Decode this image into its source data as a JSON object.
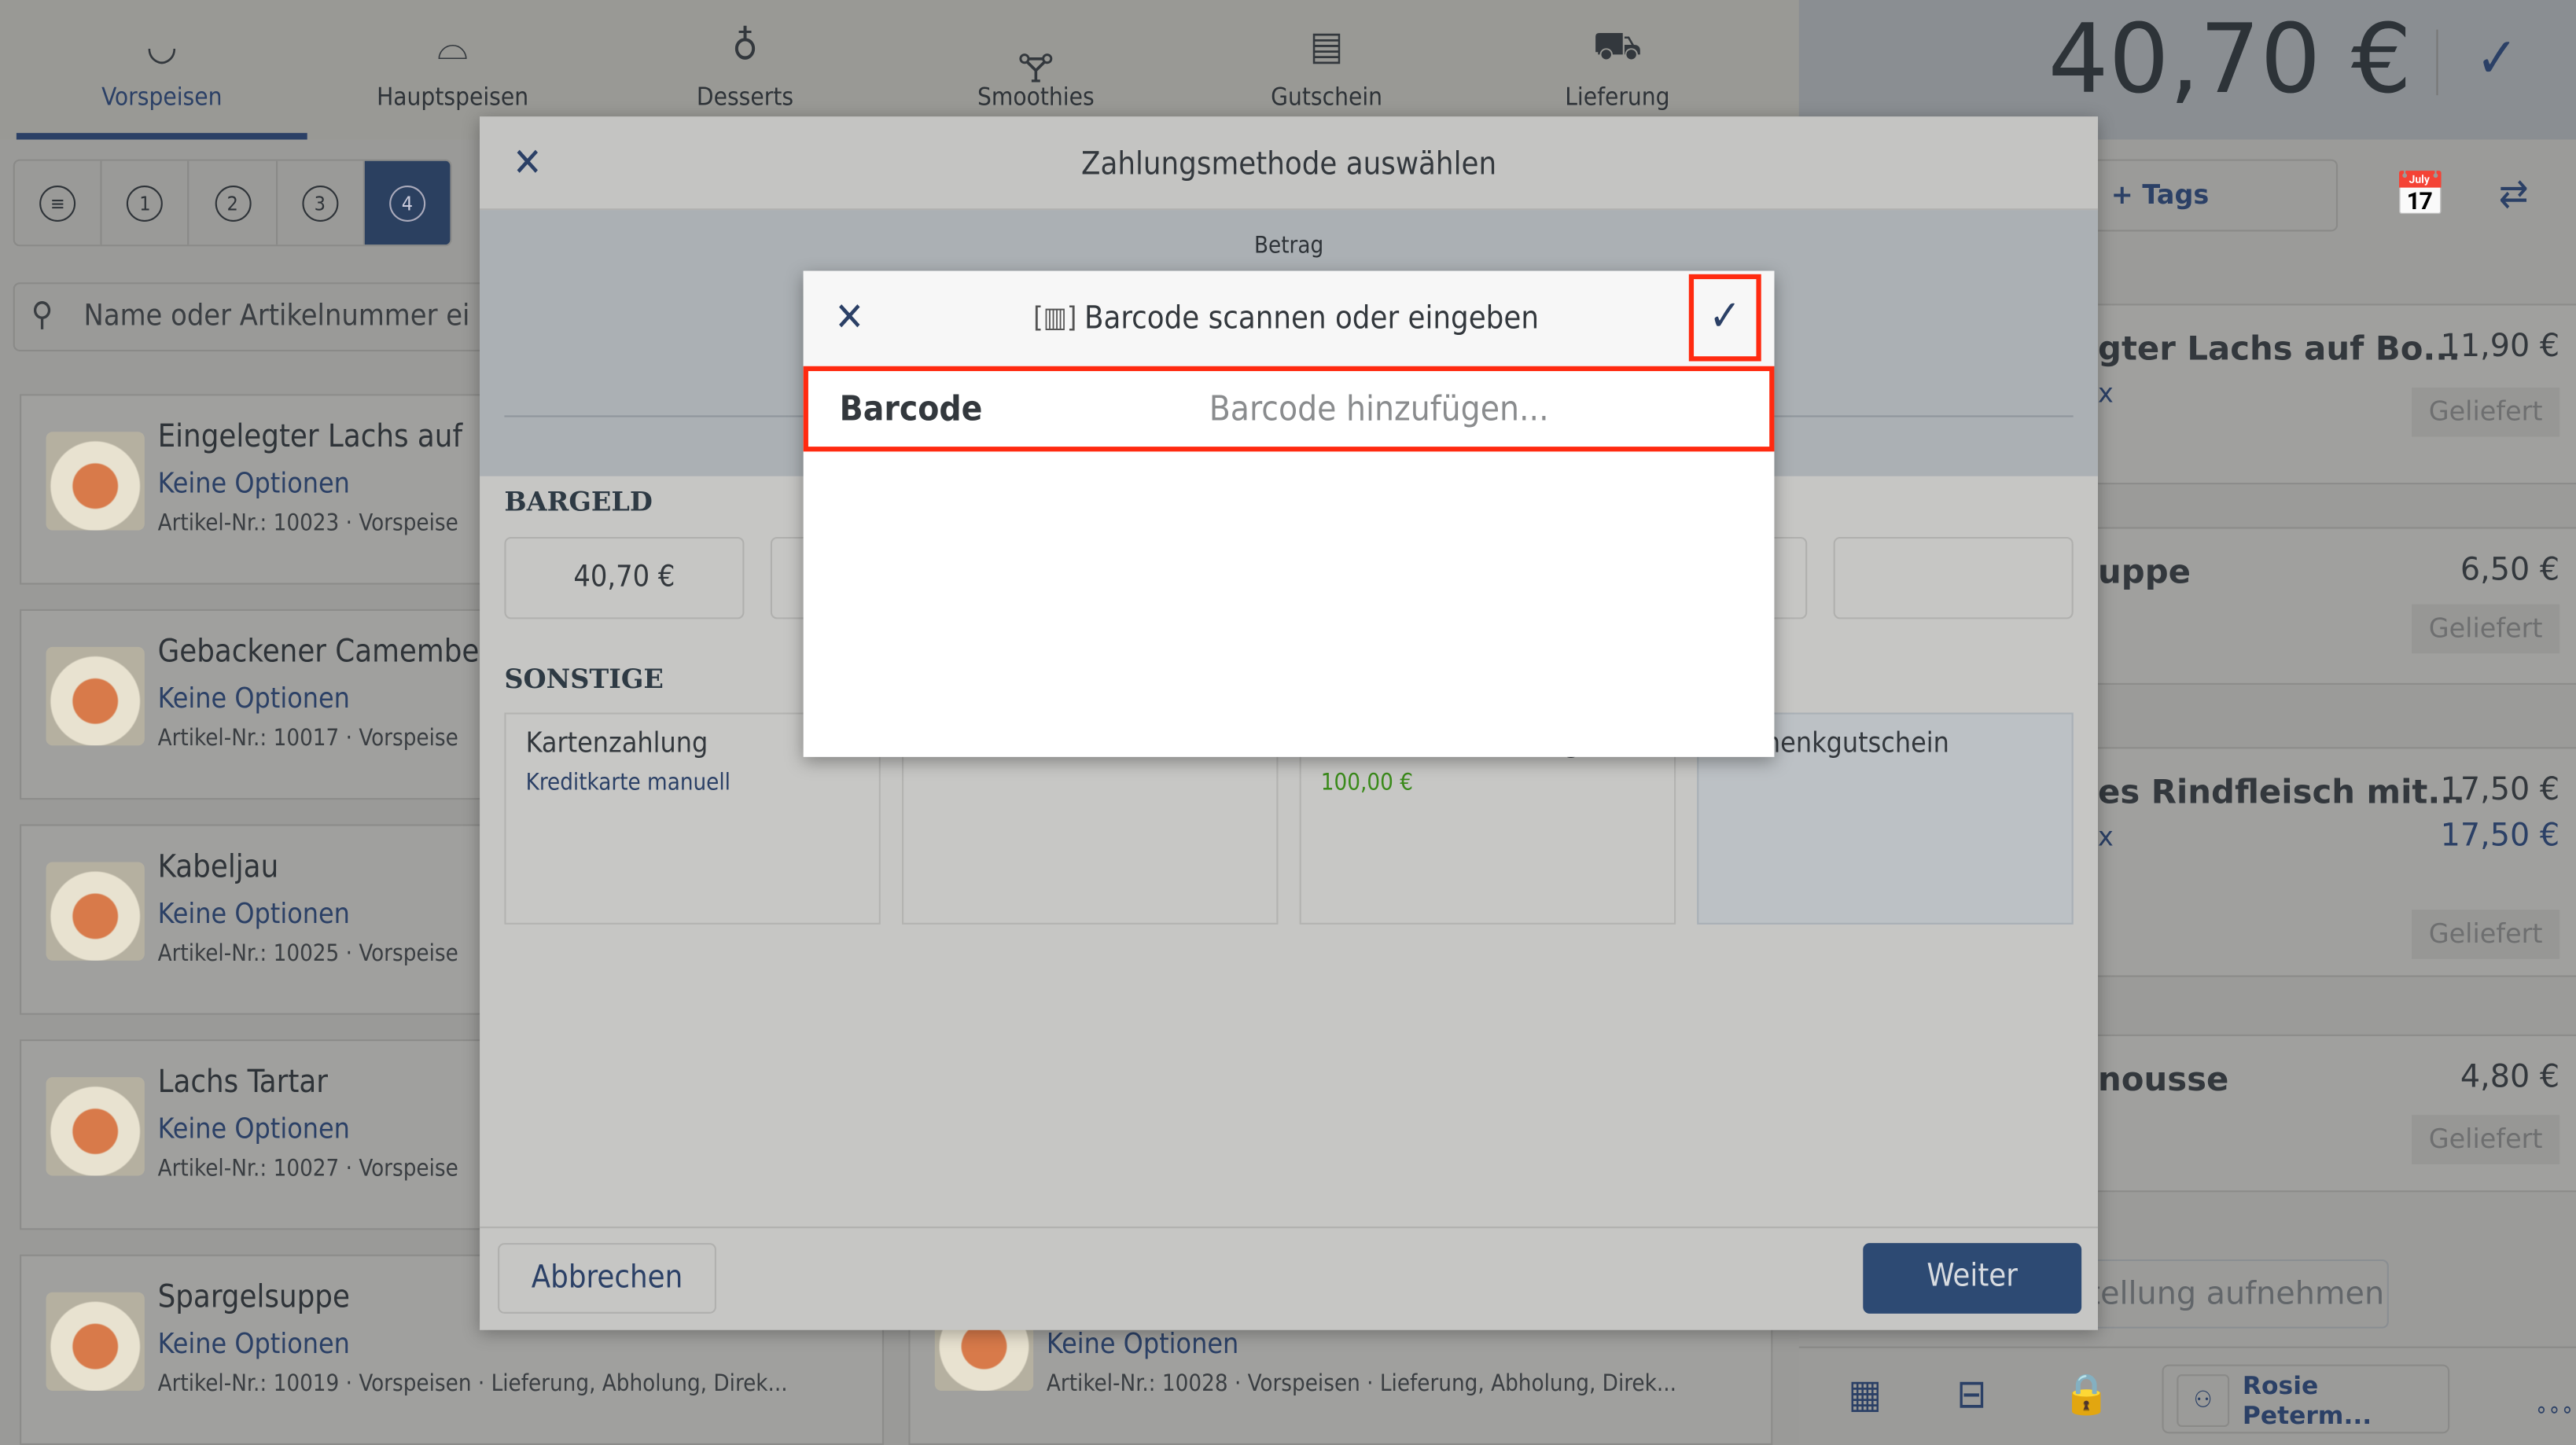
{
  "nav": {
    "tabs": [
      {
        "label": "Vorspeisen",
        "icon": "soup-bowl-icon",
        "active": true
      },
      {
        "label": "Hauptspeisen",
        "icon": "cloche-icon"
      },
      {
        "label": "Desserts",
        "icon": "sundae-icon"
      },
      {
        "label": "Smoothies",
        "icon": "bottle-icon"
      },
      {
        "label": "Gutschein",
        "icon": "voucher-icon"
      },
      {
        "label": "Lieferung",
        "icon": "delivery-truck-icon"
      }
    ]
  },
  "filters": {
    "items": [
      "1",
      "2",
      "3",
      "4"
    ],
    "active": "4"
  },
  "search": {
    "placeholder": "Name oder Artikelnummer ei"
  },
  "products": [
    {
      "name": "Eingelegter Lachs auf",
      "options": "Keine Optionen",
      "article": "Artikel-Nr.: 10023 · Vorspeise"
    },
    {
      "name": "Gebackener Camember",
      "options": "Keine Optionen",
      "article": "Artikel-Nr.: 10017 · Vorspeise"
    },
    {
      "name": "Kabeljau",
      "options": "Keine Optionen",
      "article": "Artikel-Nr.: 10025 · Vorspeise"
    },
    {
      "name": "Lachs Tartar",
      "options": "Keine Optionen",
      "article": "Artikel-Nr.: 10027 · Vorspeise"
    },
    {
      "name": "Spargelsuppe",
      "options": "Keine Optionen",
      "article": "Artikel-Nr.: 10019 · Vorspeisen · Lieferung, Abholung, Direk..."
    },
    {
      "name": "",
      "options": "Keine Optionen",
      "article": "Artikel-Nr.: 10028 · Vorspeisen · Lieferung, Abholung, Direk..."
    }
  ],
  "order": {
    "total": "40,70 €",
    "tags_label": "+ Tags",
    "items": [
      {
        "name": "gter Lachs auf Bo...",
        "qty": "x",
        "price": "11,90 €",
        "status": "Geliefert"
      },
      {
        "name": "uppe",
        "qty": "",
        "price": "6,50 €",
        "status": "Geliefert"
      },
      {
        "name": "es Rindfleisch mit...",
        "qty": "x",
        "price": "17,50 €",
        "price2": "17,50 €",
        "status": "Geliefert"
      },
      {
        "name": "nousse",
        "qty": "",
        "price": "4,80 €",
        "status": "Geliefert"
      }
    ],
    "add_button": "tellung aufnehmen",
    "user": "Rosie Peterm..."
  },
  "payment_modal": {
    "title": "Zahlungsmethode auswählen",
    "betrag_label": "Betrag",
    "cash_section": "BARGELD",
    "cash_amount": "40,70 €",
    "other_section": "SONSTIGE",
    "methods": [
      {
        "title": "Kartenzahlung",
        "subtitle": "Kreditkarte manuell"
      },
      {
        "title": "",
        "subtitle": ""
      },
      {
        "title": "g",
        "subtitle": "100,00 €"
      },
      {
        "title": "henkgutschein",
        "subtitle": "",
        "selected": true
      }
    ],
    "cancel": "Abbrechen",
    "next": "Weiter"
  },
  "barcode_dialog": {
    "title": "Barcode scannen oder eingeben",
    "field_label": "Barcode",
    "field_placeholder": "Barcode hinzufügen..."
  },
  "colors": {
    "accent": "#2b4066",
    "highlight": "#ff2a10",
    "success": "#3a8a1a"
  }
}
